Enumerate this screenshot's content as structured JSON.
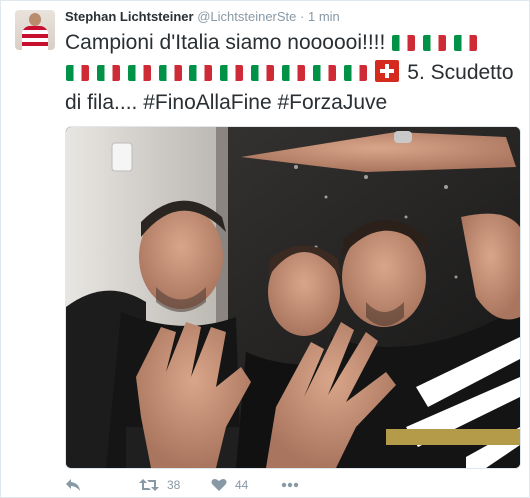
{
  "author": {
    "name": "Stephan Lichtsteiner",
    "handle": "@LichtsteinerSte",
    "separator": "·",
    "timestamp": "1 min"
  },
  "tweet": {
    "line1": "Campioni d'Italia siamo noooooi!!!!",
    "text_after_flags": "5. Scudetto di fila....",
    "hashtags": [
      "#FinoAllaFine",
      "#ForzaJuve"
    ]
  },
  "actions": {
    "retweet_count": "38",
    "like_count": "44"
  },
  "colors": {
    "text": "#292f33",
    "muted": "#8899a6",
    "border": "#e1e8ed",
    "italy_green": "#009246",
    "italy_red": "#ce2b37",
    "swiss_red": "#d52b1e"
  },
  "icons": [
    "reply-icon",
    "retweet-icon",
    "like-icon",
    "more-icon",
    "italy-flag-icon",
    "swiss-flag-icon"
  ]
}
